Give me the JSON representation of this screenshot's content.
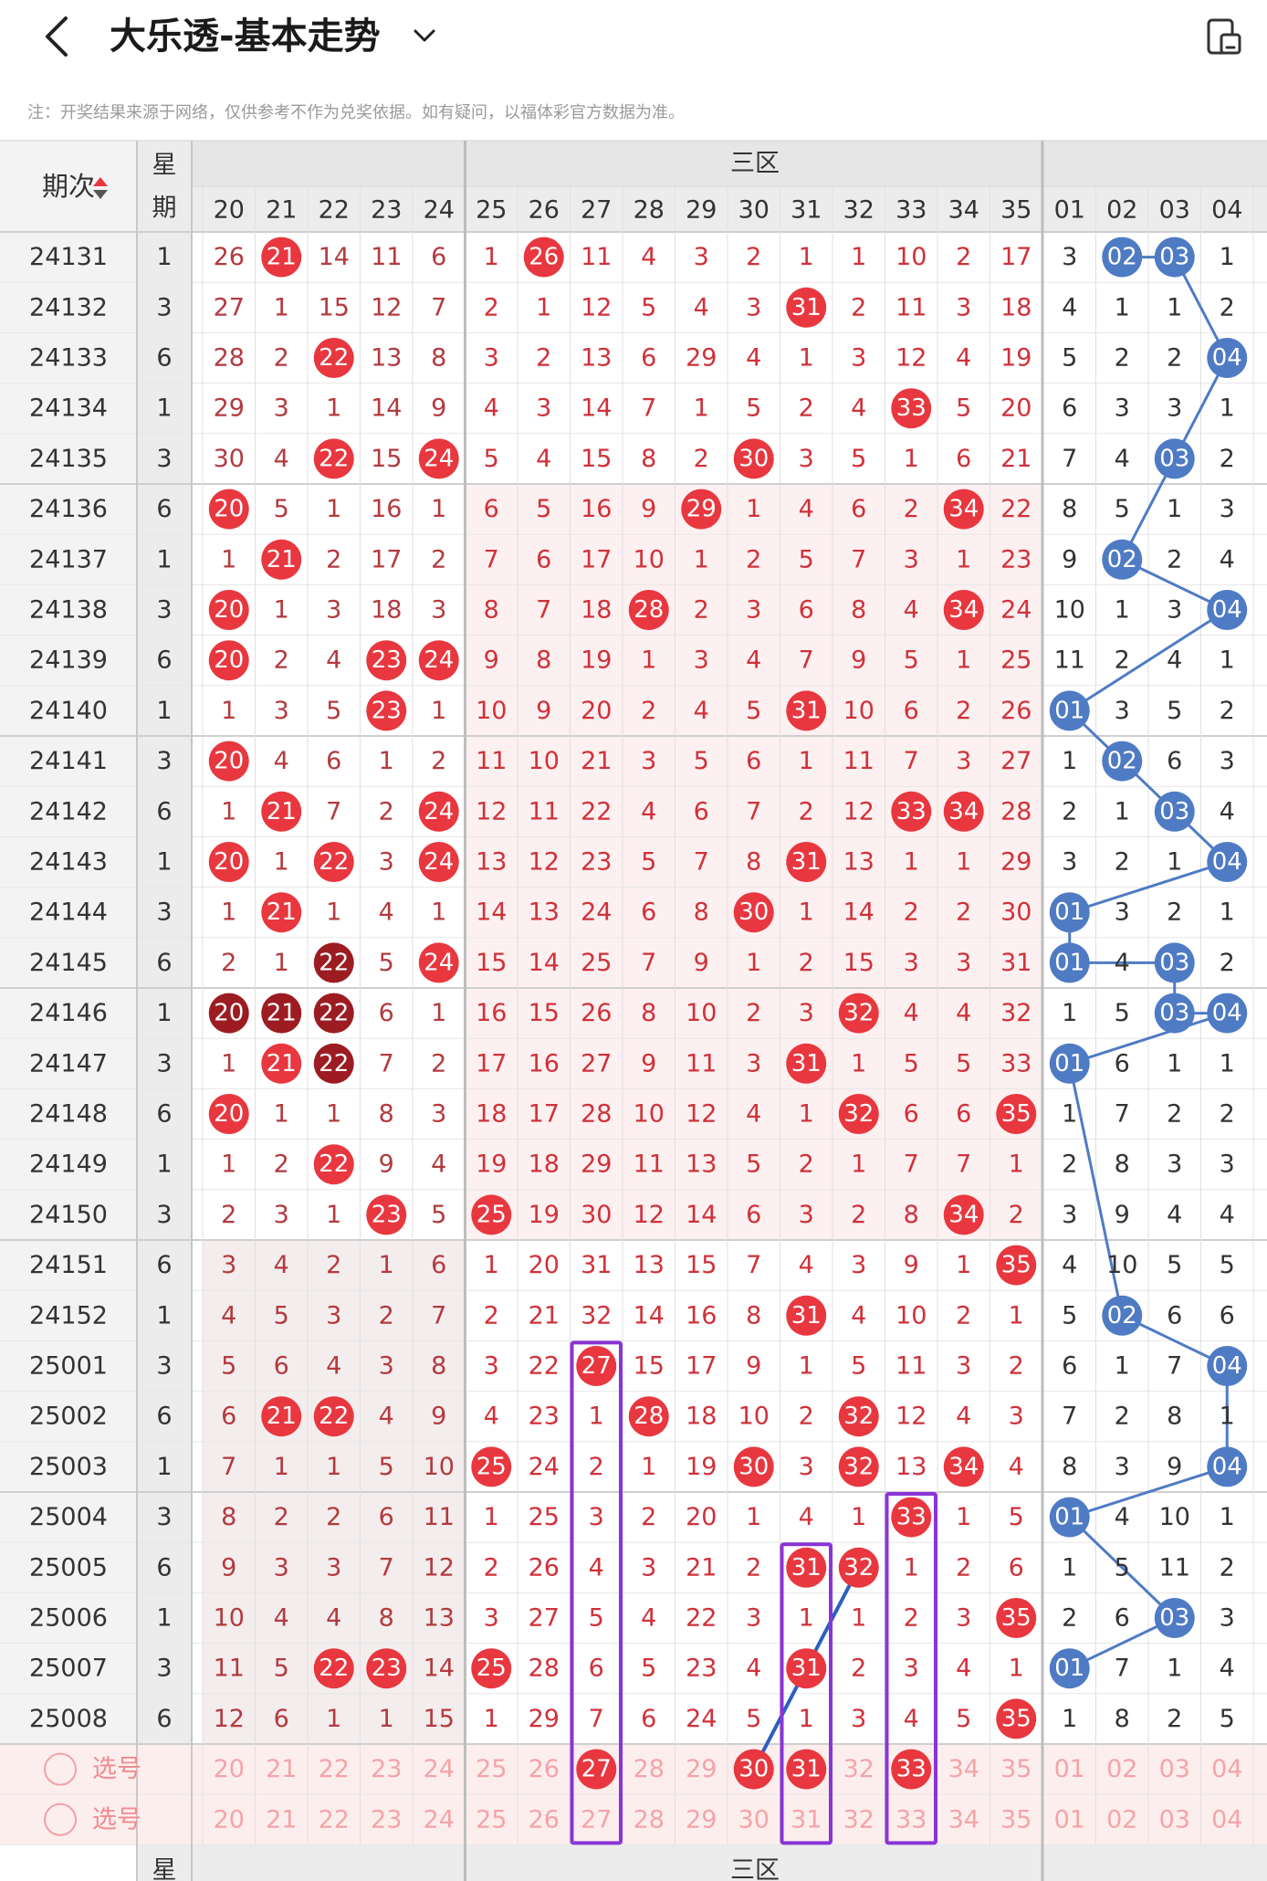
{
  "header": {
    "title": "大乐透-基本走势",
    "back_icon": "back-chevron-icon",
    "dropdown_icon": "chevron-down-icon",
    "device_icon": "device-toggle-icon"
  },
  "note": "注：开奖结果来源于网络，仅供参考不作为兑奖依据。如有疑问，以福体彩官方数据为准。",
  "table": {
    "period_header": "期次",
    "sort_icon": "sort-arrows-icon",
    "week_header_top": "星",
    "week_header_bottom": "期",
    "zone_header": "三区",
    "footer_week": "星",
    "footer_zone": "三区",
    "front_columns": [
      "20",
      "21",
      "22",
      "23",
      "24",
      "25",
      "26",
      "27",
      "28",
      "29",
      "30",
      "31",
      "32",
      "33",
      "34",
      "35"
    ],
    "back_columns": [
      "01",
      "02",
      "03",
      "04"
    ],
    "select_label": "选号",
    "rows": [
      {
        "period": "24131",
        "week": "1",
        "front": [
          "26",
          "21",
          "14",
          "11",
          "6",
          "1",
          "26",
          "11",
          "4",
          "3",
          "2",
          "1",
          "1",
          "10",
          "2",
          "17"
        ],
        "back": [
          "3",
          "02",
          "03",
          "1"
        ]
      },
      {
        "period": "24132",
        "week": "3",
        "front": [
          "27",
          "1",
          "15",
          "12",
          "7",
          "2",
          "1",
          "12",
          "5",
          "4",
          "3",
          "31",
          "2",
          "11",
          "3",
          "18"
        ],
        "back": [
          "4",
          "1",
          "1",
          "2"
        ]
      },
      {
        "period": "24133",
        "week": "6",
        "front": [
          "28",
          "2",
          "22",
          "13",
          "8",
          "3",
          "2",
          "13",
          "6",
          "29",
          "4",
          "1",
          "3",
          "12",
          "4",
          "19"
        ],
        "back": [
          "5",
          "2",
          "2",
          "04"
        ]
      },
      {
        "period": "24134",
        "week": "1",
        "front": [
          "29",
          "3",
          "1",
          "14",
          "9",
          "4",
          "3",
          "14",
          "7",
          "1",
          "5",
          "2",
          "4",
          "33",
          "5",
          "20"
        ],
        "back": [
          "6",
          "3",
          "3",
          "1"
        ]
      },
      {
        "period": "24135",
        "week": "3",
        "front": [
          "30",
          "4",
          "22",
          "15",
          "24",
          "5",
          "4",
          "15",
          "8",
          "2",
          "30",
          "3",
          "5",
          "1",
          "6",
          "21"
        ],
        "back": [
          "7",
          "4",
          "03",
          "2"
        ]
      },
      {
        "period": "24136",
        "week": "6",
        "front": [
          "20",
          "5",
          "1",
          "16",
          "1",
          "6",
          "5",
          "16",
          "9",
          "29",
          "1",
          "4",
          "6",
          "2",
          "34",
          "22"
        ],
        "back": [
          "8",
          "5",
          "1",
          "3"
        ]
      },
      {
        "period": "24137",
        "week": "1",
        "front": [
          "1",
          "21",
          "2",
          "17",
          "2",
          "7",
          "6",
          "17",
          "10",
          "1",
          "2",
          "5",
          "7",
          "3",
          "1",
          "23"
        ],
        "back": [
          "9",
          "02",
          "2",
          "4"
        ]
      },
      {
        "period": "24138",
        "week": "3",
        "front": [
          "20",
          "1",
          "3",
          "18",
          "3",
          "8",
          "7",
          "18",
          "28",
          "2",
          "3",
          "6",
          "8",
          "4",
          "34",
          "24"
        ],
        "back": [
          "10",
          "1",
          "3",
          "04"
        ]
      },
      {
        "period": "24139",
        "week": "6",
        "front": [
          "20",
          "2",
          "4",
          "23",
          "24",
          "9",
          "8",
          "19",
          "1",
          "3",
          "4",
          "7",
          "9",
          "5",
          "1",
          "25"
        ],
        "back": [
          "11",
          "2",
          "4",
          "1"
        ]
      },
      {
        "period": "24140",
        "week": "1",
        "front": [
          "1",
          "3",
          "5",
          "23",
          "1",
          "10",
          "9",
          "20",
          "2",
          "4",
          "5",
          "31",
          "10",
          "6",
          "2",
          "26"
        ],
        "back": [
          "01",
          "3",
          "5",
          "2"
        ]
      },
      {
        "period": "24141",
        "week": "3",
        "front": [
          "20",
          "4",
          "6",
          "1",
          "2",
          "11",
          "10",
          "21",
          "3",
          "5",
          "6",
          "1",
          "11",
          "7",
          "3",
          "27"
        ],
        "back": [
          "1",
          "02",
          "6",
          "3"
        ]
      },
      {
        "period": "24142",
        "week": "6",
        "front": [
          "1",
          "21",
          "7",
          "2",
          "24",
          "12",
          "11",
          "22",
          "4",
          "6",
          "7",
          "2",
          "12",
          "33",
          "34",
          "28"
        ],
        "back": [
          "2",
          "1",
          "03",
          "4"
        ]
      },
      {
        "period": "24143",
        "week": "1",
        "front": [
          "20",
          "1",
          "22",
          "3",
          "24",
          "13",
          "12",
          "23",
          "5",
          "7",
          "8",
          "31",
          "13",
          "1",
          "1",
          "29"
        ],
        "back": [
          "3",
          "2",
          "1",
          "04"
        ]
      },
      {
        "period": "24144",
        "week": "3",
        "front": [
          "1",
          "21",
          "1",
          "4",
          "1",
          "14",
          "13",
          "24",
          "6",
          "8",
          "30",
          "1",
          "14",
          "2",
          "2",
          "30"
        ],
        "back": [
          "01",
          "3",
          "2",
          "1"
        ]
      },
      {
        "period": "24145",
        "week": "6",
        "front": [
          "2",
          "1",
          "22",
          "5",
          "24",
          "15",
          "14",
          "25",
          "7",
          "9",
          "1",
          "2",
          "15",
          "3",
          "3",
          "31"
        ],
        "back": [
          "01",
          "4",
          "03",
          "2"
        ]
      },
      {
        "period": "24146",
        "week": "1",
        "front": [
          "20",
          "21",
          "22",
          "6",
          "1",
          "16",
          "15",
          "26",
          "8",
          "10",
          "2",
          "3",
          "32",
          "4",
          "4",
          "32"
        ],
        "back": [
          "1",
          "5",
          "03",
          "04"
        ]
      },
      {
        "period": "24147",
        "week": "3",
        "front": [
          "1",
          "21",
          "22",
          "7",
          "2",
          "17",
          "16",
          "27",
          "9",
          "11",
          "3",
          "31",
          "1",
          "5",
          "5",
          "33"
        ],
        "back": [
          "01",
          "6",
          "1",
          "1"
        ]
      },
      {
        "period": "24148",
        "week": "6",
        "front": [
          "20",
          "1",
          "1",
          "8",
          "3",
          "18",
          "17",
          "28",
          "10",
          "12",
          "4",
          "1",
          "32",
          "6",
          "6",
          "35"
        ],
        "back": [
          "1",
          "7",
          "2",
          "2"
        ]
      },
      {
        "period": "24149",
        "week": "1",
        "front": [
          "1",
          "2",
          "22",
          "9",
          "4",
          "19",
          "18",
          "29",
          "11",
          "13",
          "5",
          "2",
          "1",
          "7",
          "7",
          "1"
        ],
        "back": [
          "2",
          "8",
          "3",
          "3"
        ]
      },
      {
        "period": "24150",
        "week": "3",
        "front": [
          "2",
          "3",
          "1",
          "23",
          "5",
          "25",
          "19",
          "30",
          "12",
          "14",
          "6",
          "3",
          "2",
          "8",
          "34",
          "2"
        ],
        "back": [
          "3",
          "9",
          "4",
          "4"
        ]
      },
      {
        "period": "24151",
        "week": "6",
        "front": [
          "3",
          "4",
          "2",
          "1",
          "6",
          "1",
          "20",
          "31",
          "13",
          "15",
          "7",
          "4",
          "3",
          "9",
          "1",
          "35"
        ],
        "back": [
          "4",
          "10",
          "5",
          "5"
        ]
      },
      {
        "period": "24152",
        "week": "1",
        "front": [
          "4",
          "5",
          "3",
          "2",
          "7",
          "2",
          "21",
          "32",
          "14",
          "16",
          "8",
          "31",
          "4",
          "10",
          "2",
          "1"
        ],
        "back": [
          "5",
          "02",
          "6",
          "6"
        ]
      },
      {
        "period": "25001",
        "week": "3",
        "front": [
          "5",
          "6",
          "4",
          "3",
          "8",
          "3",
          "22",
          "27",
          "15",
          "17",
          "9",
          "1",
          "5",
          "11",
          "3",
          "2"
        ],
        "back": [
          "6",
          "1",
          "7",
          "04"
        ]
      },
      {
        "period": "25002",
        "week": "6",
        "front": [
          "6",
          "21",
          "22",
          "4",
          "9",
          "4",
          "23",
          "1",
          "28",
          "18",
          "10",
          "2",
          "32",
          "12",
          "4",
          "3"
        ],
        "back": [
          "7",
          "2",
          "8",
          "1"
        ]
      },
      {
        "period": "25003",
        "week": "1",
        "front": [
          "7",
          "1",
          "1",
          "5",
          "10",
          "25",
          "24",
          "2",
          "1",
          "19",
          "30",
          "3",
          "32",
          "13",
          "34",
          "4"
        ],
        "back": [
          "8",
          "3",
          "9",
          "04"
        ]
      },
      {
        "period": "25004",
        "week": "3",
        "front": [
          "8",
          "2",
          "2",
          "6",
          "11",
          "1",
          "25",
          "3",
          "2",
          "20",
          "1",
          "4",
          "1",
          "33",
          "1",
          "5"
        ],
        "back": [
          "01",
          "4",
          "10",
          "1"
        ]
      },
      {
        "period": "25005",
        "week": "6",
        "front": [
          "9",
          "3",
          "3",
          "7",
          "12",
          "2",
          "26",
          "4",
          "3",
          "21",
          "2",
          "31",
          "32",
          "1",
          "2",
          "6"
        ],
        "back": [
          "1",
          "5",
          "11",
          "2"
        ]
      },
      {
        "period": "25006",
        "week": "1",
        "front": [
          "10",
          "4",
          "4",
          "8",
          "13",
          "3",
          "27",
          "5",
          "4",
          "22",
          "3",
          "1",
          "1",
          "2",
          "3",
          "35"
        ],
        "back": [
          "2",
          "6",
          "03",
          "3"
        ]
      },
      {
        "period": "25007",
        "week": "3",
        "front": [
          "11",
          "5",
          "22",
          "23",
          "14",
          "25",
          "28",
          "6",
          "5",
          "23",
          "4",
          "31",
          "2",
          "3",
          "4",
          "1"
        ],
        "back": [
          "01",
          "7",
          "1",
          "4"
        ]
      },
      {
        "period": "25008",
        "week": "6",
        "front": [
          "12",
          "6",
          "1",
          "1",
          "15",
          "1",
          "29",
          "7",
          "6",
          "24",
          "5",
          "1",
          "3",
          "4",
          "5",
          "35"
        ],
        "back": [
          "1",
          "8",
          "2",
          "5"
        ]
      }
    ],
    "red_hits": [
      [
        1,
        6
      ],
      [
        11
      ],
      [
        2
      ],
      [
        13
      ],
      [
        2,
        4,
        10
      ],
      [
        0,
        9,
        14
      ],
      [
        1
      ],
      [
        0,
        8,
        14
      ],
      [
        0,
        3,
        4
      ],
      [
        3,
        11
      ],
      [
        0
      ],
      [
        1,
        4,
        13,
        14
      ],
      [
        0,
        2,
        4,
        11
      ],
      [
        1,
        10
      ],
      [
        2,
        4
      ],
      [
        0,
        1,
        2,
        12
      ],
      [
        1,
        2,
        11
      ],
      [
        0,
        12,
        15
      ],
      [
        2
      ],
      [
        3,
        5,
        14
      ],
      [
        15
      ],
      [
        11
      ],
      [
        7
      ],
      [
        1,
        2,
        8,
        12
      ],
      [
        5,
        10,
        12,
        14
      ],
      [
        13
      ],
      [
        11,
        12
      ],
      [
        15
      ],
      [
        2,
        3,
        5,
        11
      ],
      [
        15
      ]
    ],
    "dark_hits": [
      [
        14,
        2
      ],
      [
        15,
        0
      ],
      [
        15,
        1
      ],
      [
        15,
        2
      ],
      [
        16,
        2
      ]
    ],
    "blue_hits": [
      [
        1,
        2
      ],
      [],
      [
        3
      ],
      [],
      [
        2
      ],
      [],
      [
        1
      ],
      [
        3
      ],
      [],
      [
        0
      ],
      [
        1
      ],
      [
        2
      ],
      [
        3
      ],
      [
        0
      ],
      [
        0,
        2
      ],
      [
        2,
        3
      ],
      [
        0
      ],
      [],
      [],
      [],
      [],
      [
        1
      ],
      [
        3
      ],
      [],
      [
        3
      ],
      [
        0
      ],
      [],
      [
        2
      ],
      [
        0
      ],
      []
    ],
    "select_rows": [
      {
        "label": "选号",
        "hits": [
          7,
          10,
          11,
          13
        ]
      },
      {
        "label": "选号",
        "hits": []
      }
    ]
  },
  "colors": {
    "red_ball": "#e8373f",
    "dark_red_ball": "#9c1c22",
    "blue_ball": "#4f7bc4",
    "red_text": "#d0313a",
    "highlight_box": "#8a35d6",
    "trend_line": "#2d5fc0"
  }
}
